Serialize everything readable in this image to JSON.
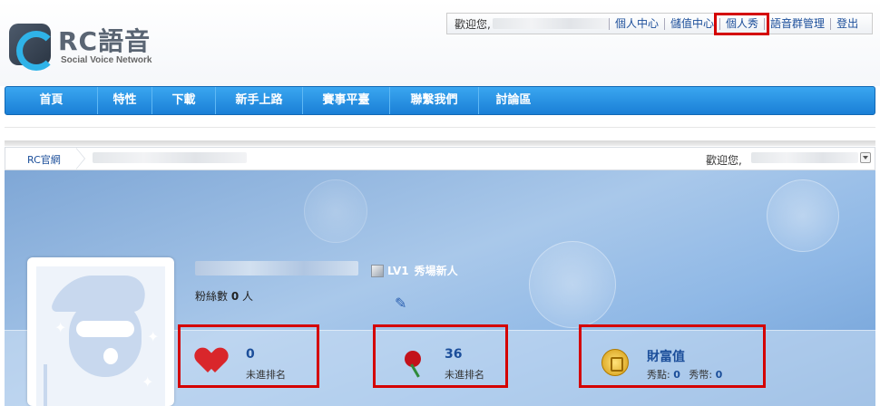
{
  "logo": {
    "brand": "RC語音",
    "tagline": "Social Voice Network"
  },
  "topbar": {
    "welcome": "歡迎您,",
    "links": [
      "個人中心",
      "儲值中心",
      "個人秀",
      "語音群管理",
      "登出"
    ]
  },
  "nav": [
    "首頁",
    "特性",
    "下載",
    "新手上路",
    "賽事平臺",
    "聯繫我們",
    "討論區"
  ],
  "breadcrumb": {
    "home": "RC官網",
    "welcome": "歡迎您,"
  },
  "profile": {
    "fans_label": "粉絲數",
    "fans_count": "0",
    "fans_unit": "人",
    "level": "LV1",
    "level_title": "秀場新人"
  },
  "stats": [
    {
      "value": "0",
      "label": "未進排名",
      "icon": "heart-icon"
    },
    {
      "value": "36",
      "label": "未進排名",
      "icon": "rose-icon"
    },
    {
      "value": "財富值",
      "label_a": "秀點:",
      "value_a": "0",
      "label_b": "秀幣:",
      "value_b": "0",
      "icon": "coin-icon"
    }
  ],
  "colors": {
    "nav": "#1a7fd6",
    "link": "#1b4e9a",
    "highlight": "#d40000"
  }
}
